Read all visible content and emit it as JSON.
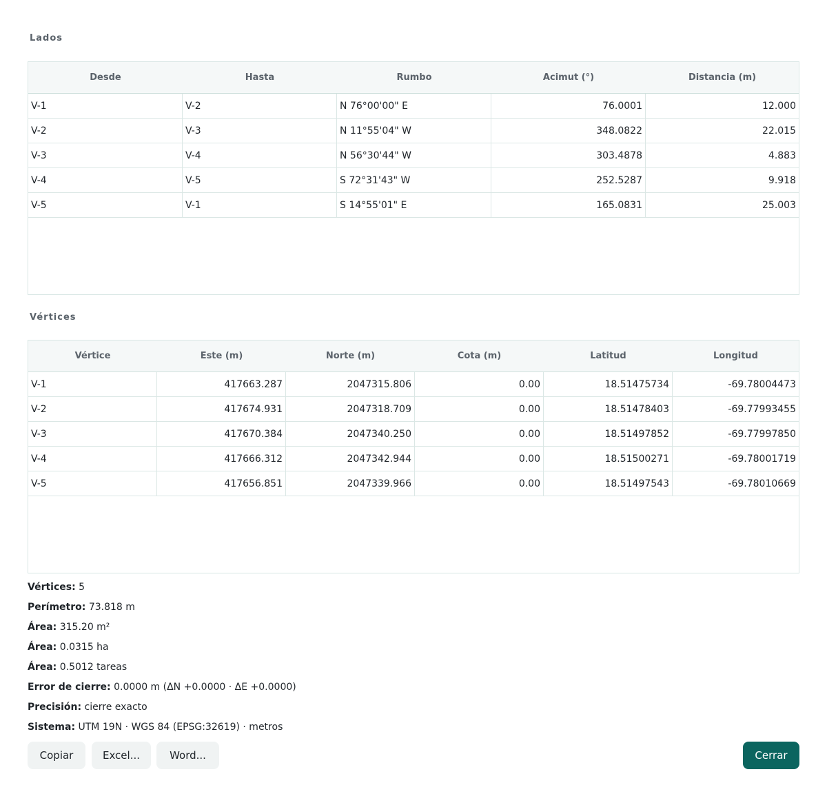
{
  "lados": {
    "title": "Lados",
    "columns": [
      "Desde",
      "Hasta",
      "Rumbo",
      "Acimut (°)",
      "Distancia (m)"
    ],
    "rows": [
      [
        "V-1",
        "V-2",
        "N 76°00'00\" E",
        "76.0001",
        "12.000"
      ],
      [
        "V-2",
        "V-3",
        "N 11°55'04\" W",
        "348.0822",
        "22.015"
      ],
      [
        "V-3",
        "V-4",
        "N 56°30'44\" W",
        "303.4878",
        "4.883"
      ],
      [
        "V-4",
        "V-5",
        "S 72°31'43\" W",
        "252.5287",
        "9.918"
      ],
      [
        "V-5",
        "V-1",
        "S 14°55'01\" E",
        "165.0831",
        "25.003"
      ]
    ]
  },
  "vertices": {
    "title": "Vértices",
    "columns": [
      "Vértice",
      "Este (m)",
      "Norte (m)",
      "Cota (m)",
      "Latitud",
      "Longitud"
    ],
    "rows": [
      [
        "V-1",
        "417663.287",
        "2047315.806",
        "0.00",
        "18.51475734",
        "-69.78004473"
      ],
      [
        "V-2",
        "417674.931",
        "2047318.709",
        "0.00",
        "18.51478403",
        "-69.77993455"
      ],
      [
        "V-3",
        "417670.384",
        "2047340.250",
        "0.00",
        "18.51497852",
        "-69.77997850"
      ],
      [
        "V-4",
        "417666.312",
        "2047342.944",
        "0.00",
        "18.51500271",
        "-69.78001719"
      ],
      [
        "V-5",
        "417656.851",
        "2047339.966",
        "0.00",
        "18.51497543",
        "-69.78010669"
      ]
    ]
  },
  "summary": [
    {
      "label": "Vértices:",
      "value": "5"
    },
    {
      "label": "Perímetro:",
      "value": "73.818 m"
    },
    {
      "label": "Área:",
      "value": "315.20 m²"
    },
    {
      "label": "Área:",
      "value": "0.0315 ha"
    },
    {
      "label": "Área:",
      "value": "0.5012 tareas"
    },
    {
      "label": "Error de cierre:",
      "value": "0.0000 m (ΔN +0.0000 · ΔE +0.0000)"
    },
    {
      "label": "Precisión:",
      "value": "cierre exacto"
    },
    {
      "label": "Sistema:",
      "value": "UTM 19N · WGS 84 (EPSG:32619) · metros"
    }
  ],
  "buttons": {
    "copy": "Copiar",
    "excel": "Excel...",
    "word": "Word...",
    "close": "Cerrar"
  },
  "colors": {
    "primary": "#0b655f",
    "header_bg": "#f5f8f8",
    "border": "#d8e6e4"
  }
}
